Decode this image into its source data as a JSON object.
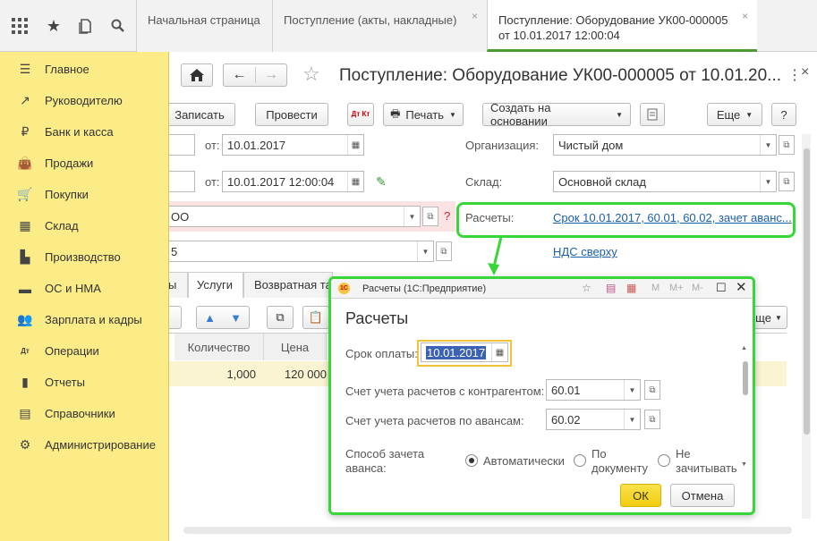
{
  "topbar": {
    "tabs": [
      {
        "label": "Начальная страница"
      },
      {
        "label": "Поступление (акты, накладные)",
        "close": "×"
      },
      {
        "line1": "Поступление: Оборудование УК00-000005",
        "line2": "от 10.01.2017 12:00:04",
        "close": "×"
      }
    ]
  },
  "sidebar": {
    "items": [
      {
        "label": "Главное",
        "icon": "menu-lines-icon"
      },
      {
        "label": "Руководителю",
        "icon": "trend-chart-icon"
      },
      {
        "label": "Банк и касса",
        "icon": "ruble-coin-icon"
      },
      {
        "label": "Продажи",
        "icon": "shopping-bag-icon"
      },
      {
        "label": "Покупки",
        "icon": "shopping-cart-icon"
      },
      {
        "label": "Склад",
        "icon": "warehouse-icon"
      },
      {
        "label": "Производство",
        "icon": "factory-icon"
      },
      {
        "label": "ОС и НМА",
        "icon": "truck-icon"
      },
      {
        "label": "Зарплата и кадры",
        "icon": "people-icon"
      },
      {
        "label": "Операции",
        "icon": "debit-credit-icon"
      },
      {
        "label": "Отчеты",
        "icon": "bar-chart-icon"
      },
      {
        "label": "Справочники",
        "icon": "books-icon"
      },
      {
        "label": "Администрирование",
        "icon": "gear-icon"
      }
    ]
  },
  "document": {
    "title": "Поступление: Оборудование УК00-000005 от 10.01.20...",
    "toolbar": {
      "save": "Записать",
      "post": "Провести",
      "dt_kt": "Дт Кт",
      "print": "Печать",
      "create_based": "Создать на основании",
      "more": "Еще",
      "help": "?"
    },
    "form": {
      "from_label": "от:",
      "date1": "10.01.2017",
      "date2": "10.01.2017 12:00:04",
      "org_label": "Организация:",
      "org_value": "Чистый дом",
      "warehouse_label": "Склад:",
      "warehouse_value": "Основной склад",
      "counterparty_partial": "ОО",
      "contract_partial": "5",
      "settlements_label": "Расчеты:",
      "settlements_link": "Срок 10.01.2017, 60.01, 60.02, зачет аванс...",
      "vat_link": "НДС сверху",
      "help_q": "?"
    },
    "tabs": {
      "tab_partial": "ы",
      "services": "Услуги",
      "returnable": "Возвратная та"
    },
    "table": {
      "headers": {
        "quantity": "Количество",
        "price": "Цена"
      },
      "row": {
        "quantity": "1,000",
        "price": "120 000"
      },
      "more_partial": "ще"
    }
  },
  "dialog": {
    "window_title": "Расчеты  (1С:Предприятие)",
    "heading": "Расчеты",
    "due_label": "Срок оплаты:",
    "due_value": "10.01.2017",
    "account_label": "Счет учета расчетов с контрагентом:",
    "account_value": "60.01",
    "advance_label": "Счет учета расчетов по авансам:",
    "advance_value": "60.02",
    "offset_label_1": "Способ зачета",
    "offset_label_2": "аванса:",
    "radio_auto": "Автоматически",
    "radio_doc_1": "По",
    "radio_doc_2": "документу",
    "radio_none_1": "Не",
    "radio_none_2": "зачитывать",
    "ok": "ОК",
    "cancel": "Отмена",
    "title_buttons": {
      "m": "M",
      "mplus": "M+",
      "mminus": "M-"
    }
  },
  "colors": {
    "sidebar_bg": "#fbec88",
    "highlight_green": "#39d63a",
    "ok_button": "#f7d71c",
    "link": "#1a5fa8"
  }
}
